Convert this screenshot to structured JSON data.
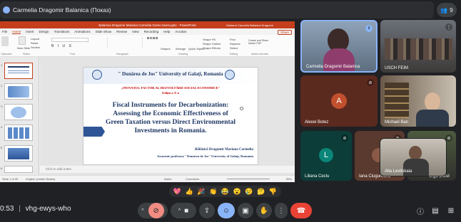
{
  "meet": {
    "presenting_label": "Carmelia Dragomir Balanica (Показ)",
    "people_count": "9",
    "meeting_time": "0:53",
    "meeting_code": "vhg-ewys-who"
  },
  "ppt": {
    "title_left": "Balanica Dragomir Mariana Carmelia Green taxes.pptx - PowerPoint",
    "title_right": "Mariana Carmelia Balanica Dragomir",
    "tabs": [
      "File",
      "Home",
      "Insert",
      "Design",
      "Transitions",
      "Animations",
      "Slide Show",
      "Review",
      "View",
      "Recording",
      "Help",
      "Acrobat"
    ],
    "share": "Share",
    "ribbon": {
      "clipboard": "Clipboard",
      "new_slide": "New Slide",
      "layout": "Layout",
      "reset": "Reset",
      "section": "Section",
      "slides": "Slides",
      "font": "Font",
      "paragraph": "Paragraph",
      "drawing": "Drawing",
      "shapes": "Shapes",
      "arrange": "Arrange",
      "quick_styles": "Quick Styles",
      "shape_fill": "Shape Fill",
      "shape_outline": "Shape Outline",
      "shape_effects": "Shape Effects",
      "find": "Find",
      "replace": "Replace",
      "select": "Select",
      "editing": "Editing",
      "create_share": "Create and Share Adobe PDF",
      "adobe": "Adobe Acrobat"
    },
    "notes": "Click to add notes",
    "status_left": "Slide 1 of 25",
    "status_lang": "English (United States)",
    "status_notes": "Notes",
    "status_comments": "Comments",
    "zoom": "55%",
    "slide": {
      "university": "\" Dunărea de Jos\" University of Galaţi, Romania",
      "conference": "„INOVAȚIA: FACTOR AL DEZVOLTĂRII SOCIAL ECONOMICE\"",
      "edition": "Ediţia a X-a",
      "title1": "Fiscal Instruments for Decarbonization:",
      "title2": "Assessing the Economic Effectiveness of",
      "title3": "Green Taxation versus Direct Environmental",
      "title4": "Investments in Romania.",
      "author": "Bălănică Dragomir Mariana Carmelia",
      "affiliation": "Associate professor,\" Dunărea de Jos\" University of Galaţi, Romania"
    }
  },
  "participants": [
    {
      "name": "Carmelia Dragomir Balanica",
      "initial": ""
    },
    {
      "name": "USCH FEIM",
      "initial": ""
    },
    {
      "name": "Alexei Botez",
      "initial": "A",
      "color": "#c1502e"
    },
    {
      "name": "Michael Ban",
      "initial": ""
    },
    {
      "name": "Liliana Ceclu",
      "initial": "L",
      "color": "#0b8579"
    },
    {
      "name": "Iana Ciugureanu",
      "initial": "",
      "color": "#6e4536"
    },
    {
      "name": "Olga Dorul",
      "initial": ""
    },
    {
      "name": "Alla Levitskaia",
      "initial": ""
    }
  ],
  "reactions": [
    "💖",
    "👍",
    "🎉",
    "👏",
    "😂",
    "😮",
    "😢",
    "🤔",
    "👎"
  ],
  "colors": {
    "ppt_accent": "#c43e1c",
    "end_call": "#ea4335",
    "active_speaker": "#8ab4f8"
  }
}
